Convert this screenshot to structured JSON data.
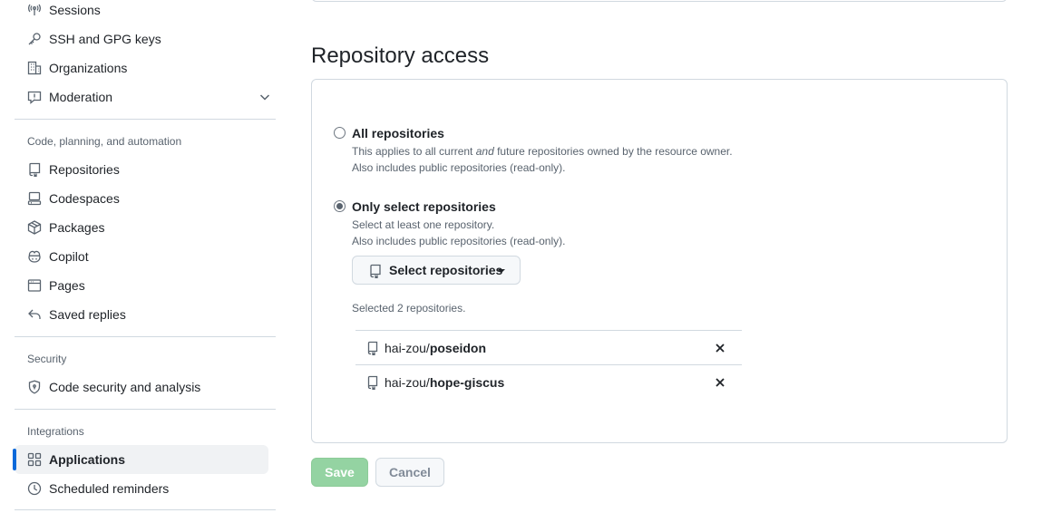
{
  "sidebar": {
    "items_top": [
      {
        "label": "Sessions",
        "icon": "broadcast-icon"
      },
      {
        "label": "SSH and GPG keys",
        "icon": "key-icon"
      },
      {
        "label": "Organizations",
        "icon": "organization-icon"
      },
      {
        "label": "Moderation",
        "icon": "report-icon"
      }
    ],
    "groups": [
      {
        "heading": "Code, planning, and automation",
        "items": [
          {
            "label": "Repositories",
            "icon": "repo-icon"
          },
          {
            "label": "Codespaces",
            "icon": "codespaces-icon"
          },
          {
            "label": "Packages",
            "icon": "package-icon"
          },
          {
            "label": "Copilot",
            "icon": "copilot-icon"
          },
          {
            "label": "Pages",
            "icon": "browser-icon"
          },
          {
            "label": "Saved replies",
            "icon": "reply-icon"
          }
        ]
      },
      {
        "heading": "Security",
        "items": [
          {
            "label": "Code security and analysis",
            "icon": "shield-lock-icon"
          }
        ]
      },
      {
        "heading": "Integrations",
        "items": [
          {
            "label": "Applications",
            "icon": "apps-icon",
            "active": true
          },
          {
            "label": "Scheduled reminders",
            "icon": "clock-icon"
          }
        ]
      }
    ]
  },
  "main": {
    "heading": "Repository access",
    "options": [
      {
        "title": "All repositories",
        "note_line1_pre": "This applies to all current ",
        "note_line1_em": "and",
        "note_line1_post": " future repositories owned by the resource owner.",
        "note_line2": "Also includes public repositories (read-only).",
        "selected": false
      },
      {
        "title": "Only select repositories",
        "note_line1": "Select at least one repository.",
        "note_line2": "Also includes public repositories (read-only).",
        "selected": true
      }
    ],
    "select_button": "Select repositories",
    "selected_count_text": "Selected 2 repositories.",
    "repos": [
      {
        "owner": "hai-zou/",
        "name": "poseidon"
      },
      {
        "owner": "hai-zou/",
        "name": "hope-giscus"
      }
    ],
    "save_label": "Save",
    "cancel_label": "Cancel"
  },
  "colors": {
    "accent": "#0969da",
    "save_disabled": "#94d3a2",
    "muted_text": "#59636e",
    "border": "#d1d9e0"
  }
}
